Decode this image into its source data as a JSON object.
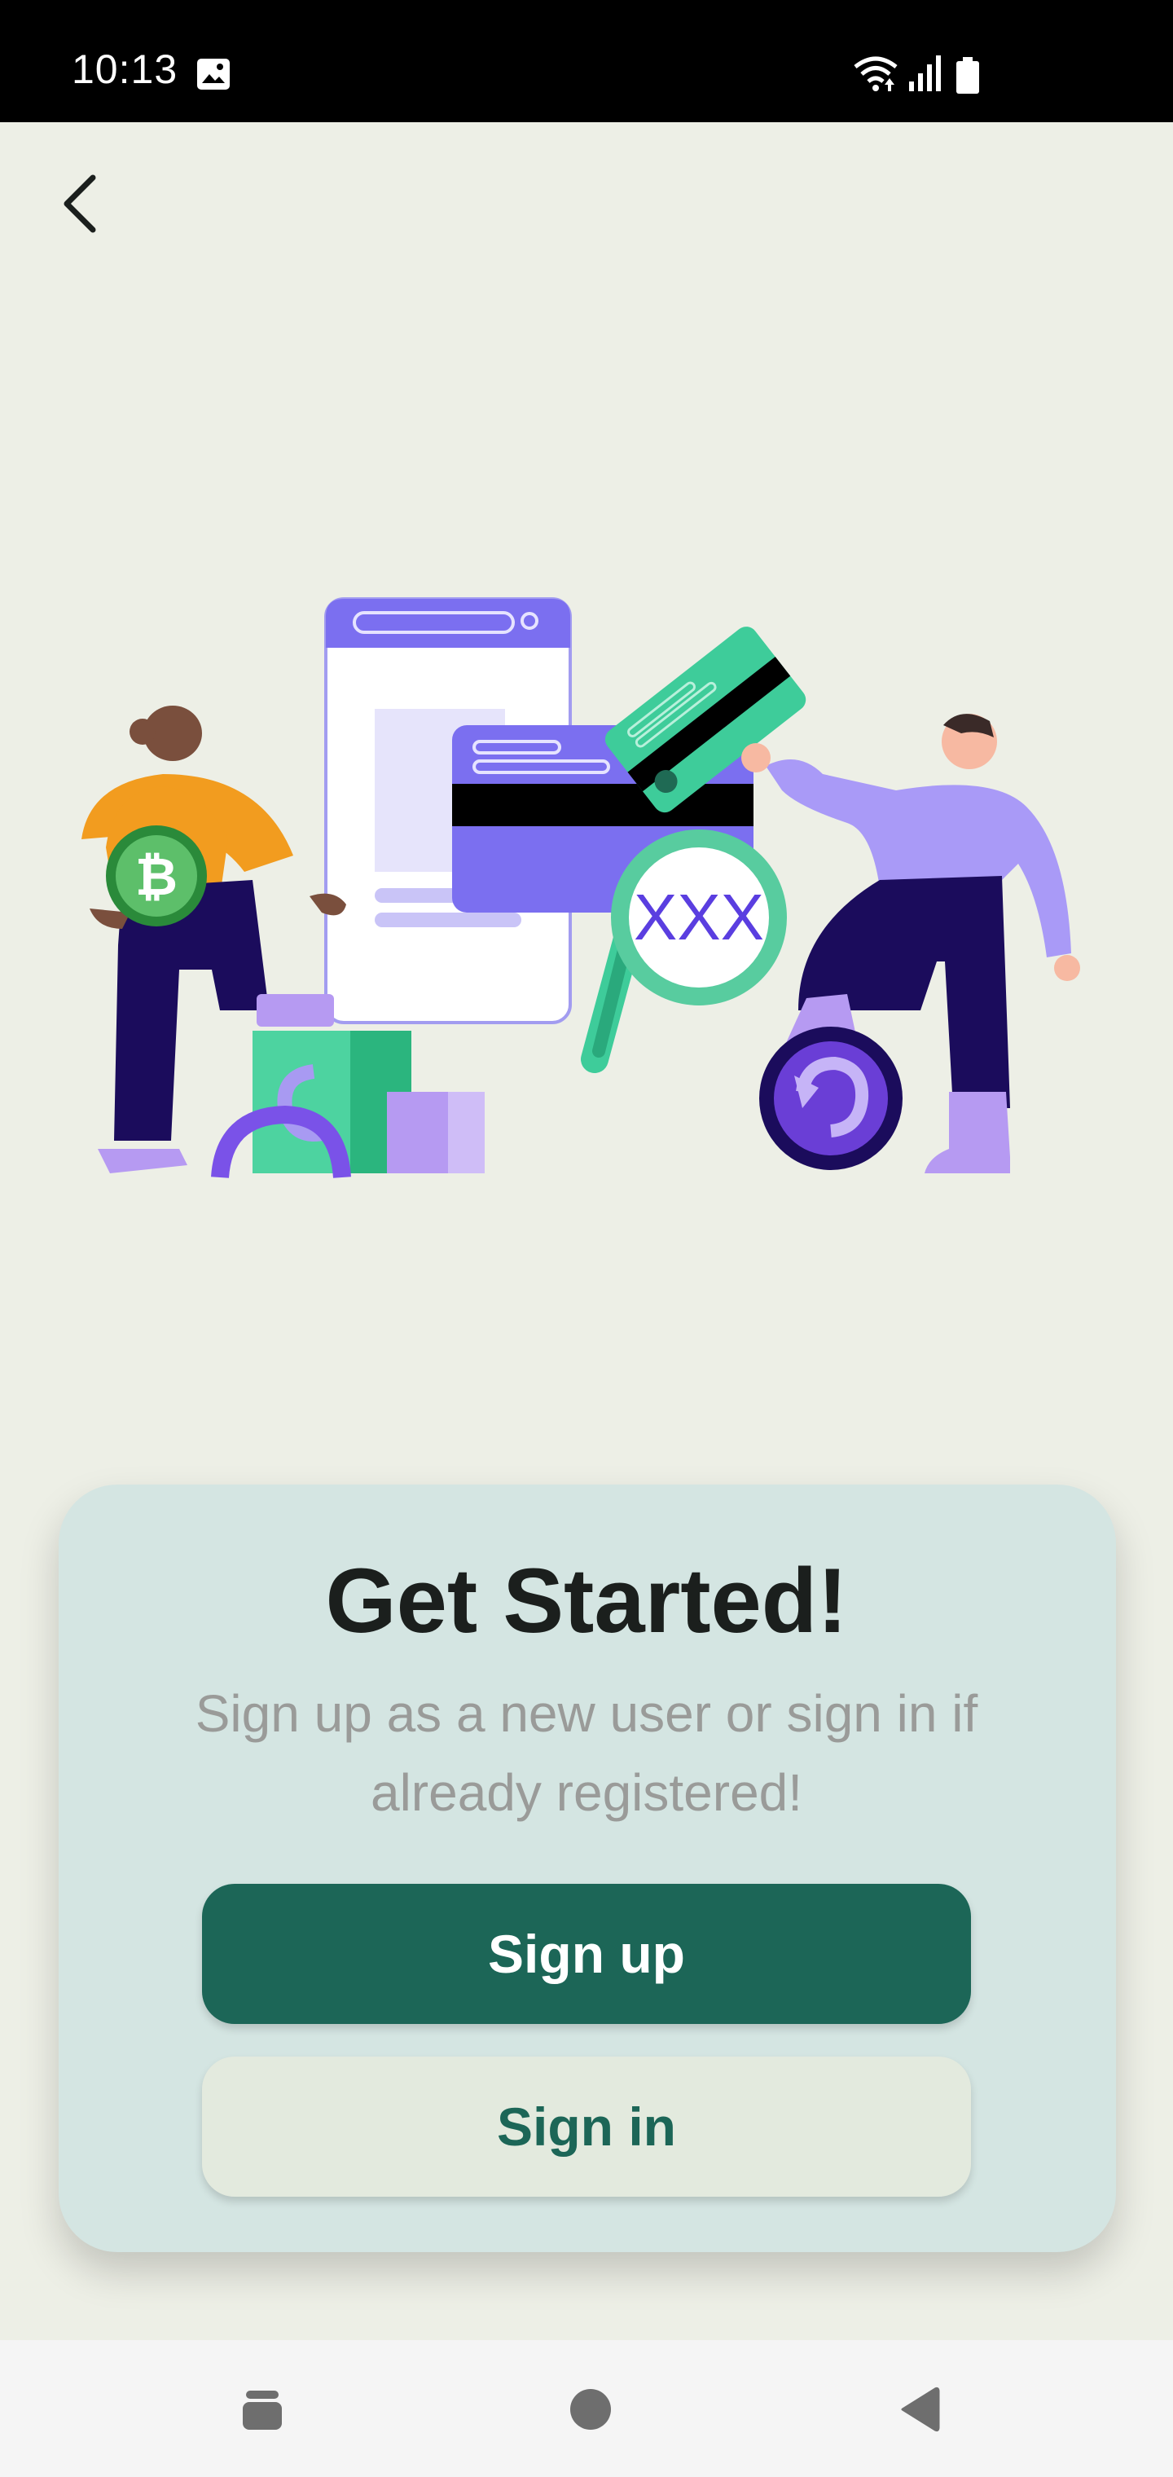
{
  "status_bar": {
    "time": "10:13",
    "icons": [
      "gallery-icon",
      "wifi-icon",
      "signal-icon",
      "battery-icon"
    ]
  },
  "top_bar": {
    "back_icon": "chevron-left-icon"
  },
  "illustration": {
    "card_text": "XXX",
    "icons": [
      "bitcoin-icon",
      "credit-card-icon",
      "magnifier-icon",
      "refresh-coin-icon"
    ]
  },
  "card": {
    "title": "Get Started!",
    "subtitle": "Sign up as a new user or sign in if already registered!",
    "signup_label": "Sign up",
    "signin_label": "Sign in"
  },
  "nav_bar": {
    "icons": [
      "recents-icon",
      "home-icon",
      "back-icon"
    ]
  },
  "colors": {
    "background": "#edefe6",
    "card": "#d4e5e2",
    "primary": "#1c6657",
    "secondary_button": "#e3eade",
    "title_text": "#1b1f1d",
    "subtitle_text": "#9a9b99"
  }
}
